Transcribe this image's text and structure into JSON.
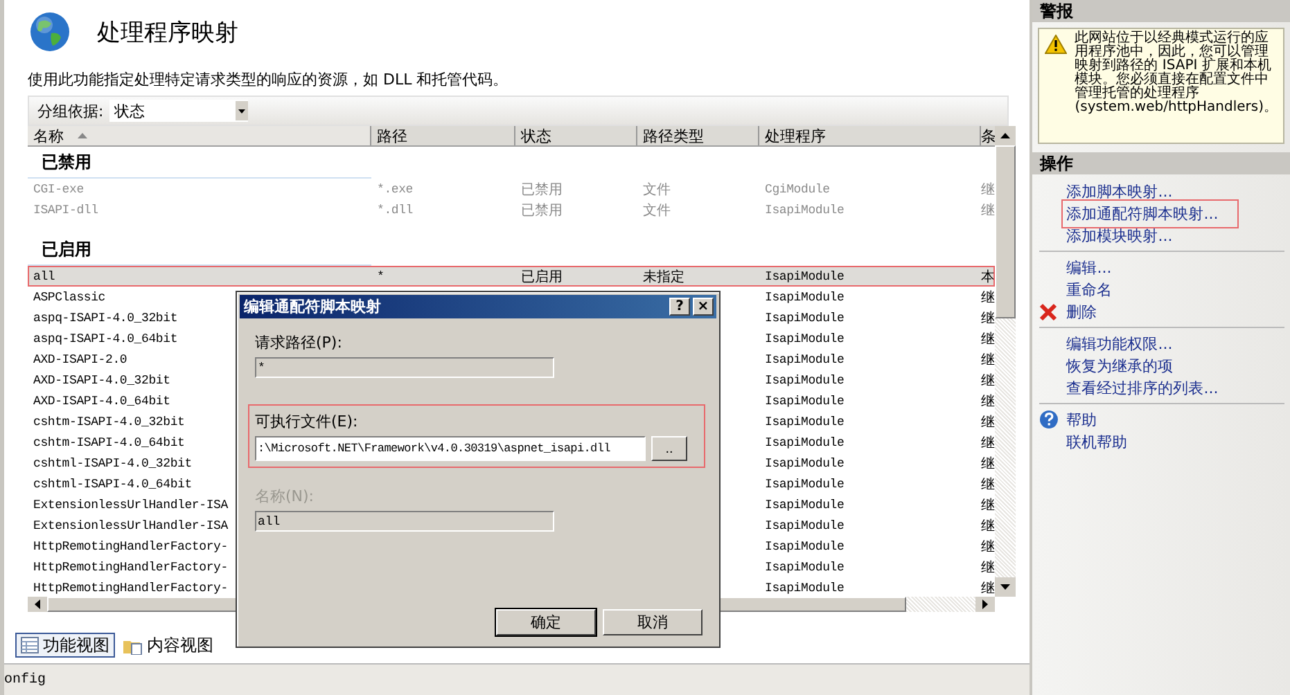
{
  "header": {
    "title": "处理程序映射",
    "description": "使用此功能指定处理特定请求类型的响应的资源，如 DLL 和托管代码。"
  },
  "group_by": {
    "label": "分组依据:",
    "value": "状态"
  },
  "table": {
    "columns": [
      {
        "label": "名称",
        "sorted": true
      },
      {
        "label": "路径",
        "sorted": false
      },
      {
        "label": "状态",
        "sorted": false
      },
      {
        "label": "路径类型",
        "sorted": false
      },
      {
        "label": "处理程序",
        "sorted": false
      },
      {
        "label": "条",
        "sorted": false
      }
    ],
    "groups": [
      {
        "label": "已禁用",
        "rows": [
          {
            "name": "CGI-exe",
            "path": "*.exe",
            "status": "已禁用",
            "path_type": "文件",
            "handler": "CgiModule",
            "column_6": "继",
            "disabled": true,
            "selected": false,
            "highlighted": false
          },
          {
            "name": "ISAPI-dll",
            "path": "*.dll",
            "status": "已禁用",
            "path_type": "文件",
            "handler": "IsapiModule",
            "column_6": "继",
            "disabled": true,
            "selected": false,
            "highlighted": false
          }
        ]
      },
      {
        "label": "已启用",
        "rows": [
          {
            "name": "all",
            "path": "*",
            "status": "已启用",
            "path_type": "未指定",
            "handler": "IsapiModule",
            "column_6": "本",
            "disabled": false,
            "selected": true,
            "highlighted": true
          },
          {
            "name": "ASPClassic",
            "handler": "IsapiModule",
            "column_6": "继",
            "disabled": false,
            "selected": false,
            "highlighted": false
          },
          {
            "name": "aspq-ISAPI-4.0_32bit",
            "handler": "IsapiModule",
            "column_6": "继",
            "disabled": false,
            "selected": false,
            "highlighted": false
          },
          {
            "name": "aspq-ISAPI-4.0_64bit",
            "handler": "IsapiModule",
            "column_6": "继",
            "disabled": false,
            "selected": false,
            "highlighted": false
          },
          {
            "name": "AXD-ISAPI-2.0",
            "handler": "IsapiModule",
            "column_6": "继",
            "disabled": false,
            "selected": false,
            "highlighted": false
          },
          {
            "name": "AXD-ISAPI-4.0_32bit",
            "handler": "IsapiModule",
            "column_6": "继",
            "disabled": false,
            "selected": false,
            "highlighted": false
          },
          {
            "name": "AXD-ISAPI-4.0_64bit",
            "handler": "IsapiModule",
            "column_6": "继",
            "disabled": false,
            "selected": false,
            "highlighted": false
          },
          {
            "name": "cshtm-ISAPI-4.0_32bit",
            "handler": "IsapiModule",
            "column_6": "继",
            "disabled": false,
            "selected": false,
            "highlighted": false
          },
          {
            "name": "cshtm-ISAPI-4.0_64bit",
            "handler": "IsapiModule",
            "column_6": "继",
            "disabled": false,
            "selected": false,
            "highlighted": false
          },
          {
            "name": "cshtml-ISAPI-4.0_32bit",
            "handler": "IsapiModule",
            "column_6": "继",
            "disabled": false,
            "selected": false,
            "highlighted": false
          },
          {
            "name": "cshtml-ISAPI-4.0_64bit",
            "handler": "IsapiModule",
            "column_6": "继",
            "disabled": false,
            "selected": false,
            "highlighted": false
          },
          {
            "name": "ExtensionlessUrlHandler-ISA",
            "handler": "IsapiModule",
            "column_6": "继",
            "disabled": false,
            "selected": false,
            "highlighted": false
          },
          {
            "name": "ExtensionlessUrlHandler-ISA",
            "handler": "IsapiModule",
            "column_6": "继",
            "disabled": false,
            "selected": false,
            "highlighted": false
          },
          {
            "name": "HttpRemotingHandlerFactory-",
            "handler": "IsapiModule",
            "column_6": "继",
            "disabled": false,
            "selected": false,
            "highlighted": false
          },
          {
            "name": "HttpRemotingHandlerFactory-",
            "handler": "IsapiModule",
            "column_6": "继",
            "disabled": false,
            "selected": false,
            "highlighted": false
          },
          {
            "name": "HttpRemotingHandlerFactory-",
            "handler": "IsapiModule",
            "column_6": "继",
            "disabled": false,
            "selected": false,
            "highlighted": false
          }
        ]
      }
    ]
  },
  "view_tabs": [
    {
      "label": "功能视图",
      "kind": "features",
      "selected": true
    },
    {
      "label": "内容视图",
      "kind": "content",
      "selected": false
    }
  ],
  "status_bar": {
    "text": "onfig"
  },
  "dialog": {
    "title": "编辑通配符脚本映射",
    "title_buttons": [
      "?",
      "×"
    ],
    "fields": [
      {
        "label": "请求路径(P):",
        "value": "*",
        "readonly": true,
        "disabled": false,
        "highlighted": false
      },
      {
        "label": "可执行文件(E):",
        "value": ":\\Microsoft.NET\\Framework\\v4.0.30319\\aspnet_isapi.dll",
        "readonly": false,
        "disabled": false,
        "highlighted": true,
        "browse_button": ".."
      },
      {
        "label": "名称(N):",
        "value": "all",
        "readonly": true,
        "disabled": true,
        "highlighted": false
      }
    ],
    "buttons": [
      "确定",
      "取消"
    ]
  },
  "alerts": {
    "title": "警报",
    "message": "此网站位于以经典模式运行的应用程序池中，因此，您可以管理映射到路径的 ISAPI 扩展和本机模块。您必须直接在配置文件中管理托管的处理程序 (system.web/httpHandlers)。"
  },
  "actions": {
    "title": "操作",
    "groups": [
      [
        {
          "label": "添加脚本映射...",
          "kind": "link",
          "highlighted": false
        },
        {
          "label": "添加通配符脚本映射...",
          "kind": "link",
          "highlighted": true
        },
        {
          "label": "添加模块映射...",
          "kind": "link",
          "highlighted": false
        }
      ],
      [
        {
          "label": "编辑...",
          "kind": "link",
          "highlighted": false
        },
        {
          "label": "重命名",
          "kind": "link",
          "highlighted": false
        },
        {
          "label": "删除",
          "kind": "delete",
          "highlighted": false
        }
      ],
      [
        {
          "label": "编辑功能权限...",
          "kind": "link",
          "highlighted": false
        },
        {
          "label": "恢复为继承的项",
          "kind": "link",
          "highlighted": false
        },
        {
          "label": "查看经过排序的列表...",
          "kind": "link",
          "highlighted": false
        }
      ],
      [
        {
          "label": "帮助",
          "kind": "help",
          "highlighted": false
        },
        {
          "label": "联机帮助",
          "kind": "link",
          "highlighted": false
        }
      ]
    ]
  }
}
